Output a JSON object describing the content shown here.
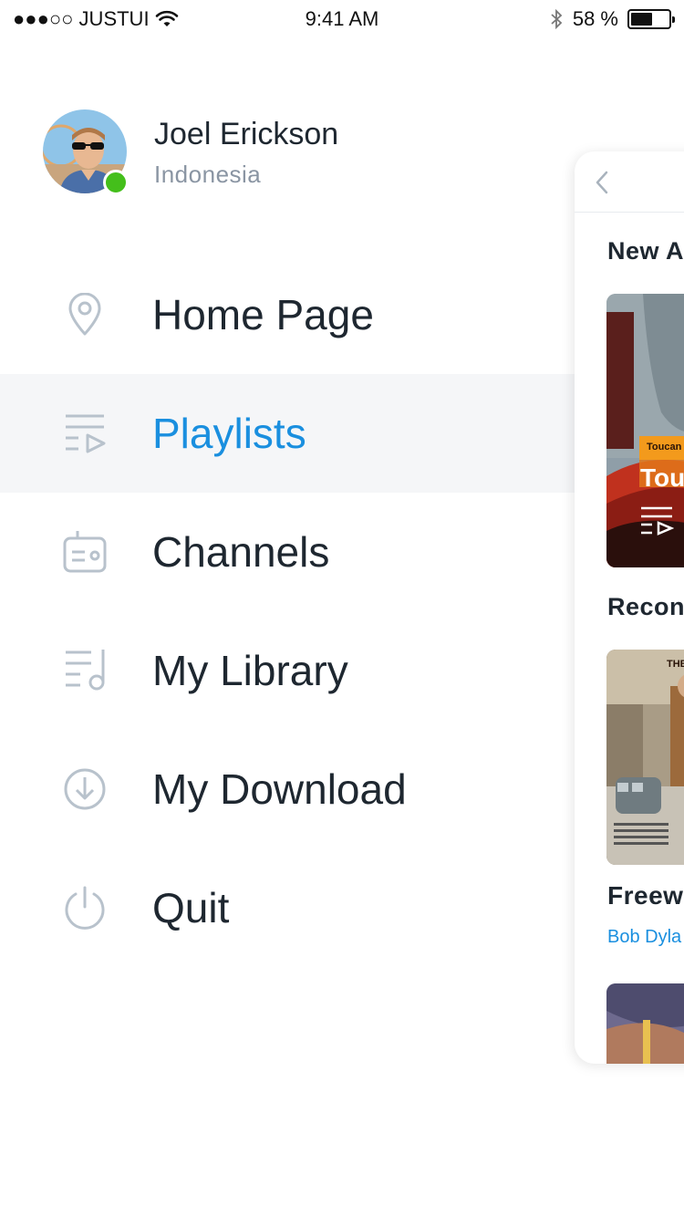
{
  "status_bar": {
    "carrier": "●●●○○ JUSTUI",
    "time": "9:41 AM",
    "battery_text": "58 %",
    "battery_level": 0.58
  },
  "profile": {
    "name": "Joel Erickson",
    "location": "Indonesia",
    "status_color": "#44bf1b"
  },
  "menu": {
    "items": [
      {
        "label": "Home Page",
        "icon": "location-pin-icon"
      },
      {
        "label": "Playlists",
        "icon": "playlist-icon",
        "active": true
      },
      {
        "label": "Channels",
        "icon": "radio-icon"
      },
      {
        "label": "My Library",
        "icon": "library-icon"
      },
      {
        "label": "My Download",
        "icon": "download-icon"
      },
      {
        "label": "Quit",
        "icon": "power-icon"
      }
    ],
    "active_color": "#1a8fdf"
  },
  "panel": {
    "new_heading": "New A",
    "card1_title": "Tou",
    "card1_tag": "Toucan l",
    "recommended_heading": "Recon",
    "card2_tag": "THE",
    "card2_title": "Freew",
    "card2_artist": "Bob Dyla"
  }
}
